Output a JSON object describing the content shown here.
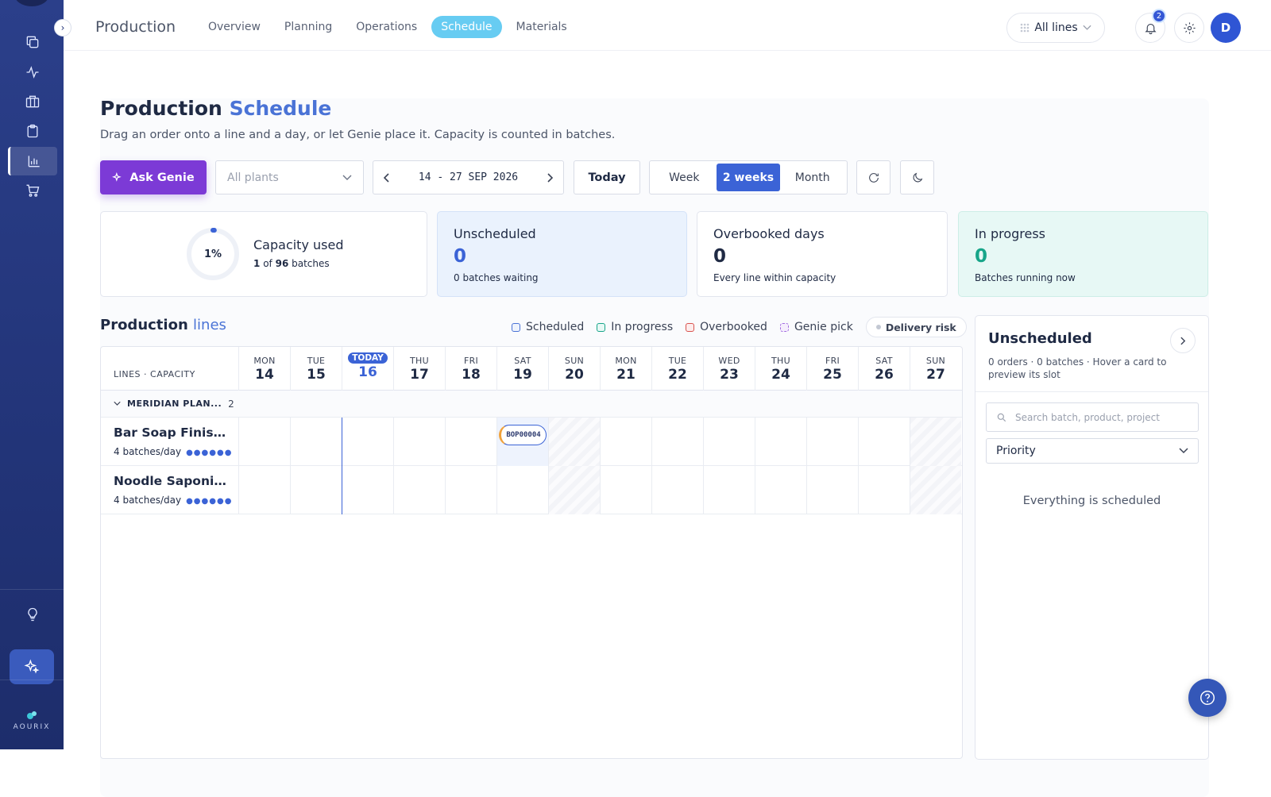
{
  "app": {
    "title": "Production"
  },
  "nav": {
    "tabs": [
      {
        "label": "Overview"
      },
      {
        "label": "Planning"
      },
      {
        "label": "Operations"
      },
      {
        "label": "Schedule",
        "active": true
      },
      {
        "label": "Materials"
      }
    ]
  },
  "header": {
    "lines_filter": "All lines",
    "notifications_count": "2",
    "user_initial": "D"
  },
  "brand": {
    "name": "AOURIX"
  },
  "page": {
    "title_main": "Production",
    "title_accent": "Schedule",
    "subtitle": "Drag an order onto a line and a day, or let Genie place it. Capacity is counted in batches."
  },
  "toolbar": {
    "ask_genie": "Ask Genie",
    "plants_placeholder": "All plants",
    "date_range": "14 - 27 SEP 2026",
    "today": "Today",
    "views": [
      "Week",
      "2 weeks",
      "Month"
    ],
    "active_view": "2 weeks"
  },
  "stats": {
    "capacity": {
      "percent_label": "1%",
      "label": "Capacity used",
      "used": "1",
      "of": "of",
      "total": "96",
      "unit": "batches",
      "fraction": 0.01
    },
    "unscheduled": {
      "label": "Unscheduled",
      "value": "0",
      "desc": "0 batches waiting"
    },
    "overbooked": {
      "label": "Overbooked days",
      "value": "0",
      "desc": "Every line within capacity"
    },
    "in_progress": {
      "label": "In progress",
      "value": "0",
      "desc": "Batches running now"
    }
  },
  "lines_section": {
    "title_main": "Production",
    "title_accent": "lines",
    "legend": [
      {
        "label": "Scheduled",
        "color": "#4a73d6"
      },
      {
        "label": "In progress",
        "color": "#17a589"
      },
      {
        "label": "Overbooked",
        "color": "#d9534f"
      },
      {
        "label": "Genie pick",
        "color": "#a46ee0"
      }
    ],
    "delivery_risk": "Delivery risk"
  },
  "grid": {
    "head_label": "LINES · CAPACITY",
    "days": [
      {
        "name": "MON",
        "num": "14"
      },
      {
        "name": "TUE",
        "num": "15"
      },
      {
        "name": "TODAY",
        "num": "16",
        "today": true
      },
      {
        "name": "THU",
        "num": "17"
      },
      {
        "name": "FRI",
        "num": "18"
      },
      {
        "name": "SAT",
        "num": "19"
      },
      {
        "name": "SUN",
        "num": "20"
      },
      {
        "name": "MON",
        "num": "21"
      },
      {
        "name": "TUE",
        "num": "22"
      },
      {
        "name": "WED",
        "num": "23"
      },
      {
        "name": "THU",
        "num": "24"
      },
      {
        "name": "FRI",
        "num": "25"
      },
      {
        "name": "SAT",
        "num": "26"
      },
      {
        "name": "SUN",
        "num": "27"
      }
    ],
    "plant": {
      "name": "MERIDIAN PLAN...",
      "count": "2"
    },
    "lines": [
      {
        "name": "Bar Soap Finish...",
        "capacity": "4 batches/day",
        "capacity_dots": "●●●●●●"
      },
      {
        "name": "Noodle Saponifi...",
        "capacity": "4 batches/day",
        "capacity_dots": "●●●●●●"
      }
    ],
    "batch": {
      "id": "BOP00004",
      "line": 0,
      "day": "SAT 19"
    }
  },
  "unscheduled_panel": {
    "title": "Unscheduled",
    "desc": "0 orders · 0 batches · Hover a card to preview its slot",
    "search_placeholder": "Search batch, product, project",
    "sort": "Priority",
    "empty": "Everything is scheduled"
  },
  "colors": {
    "accent": "#3b63d6",
    "genie": "#7c3ad6",
    "sidebar": "#223478",
    "nav_active": "#67ccf2"
  }
}
